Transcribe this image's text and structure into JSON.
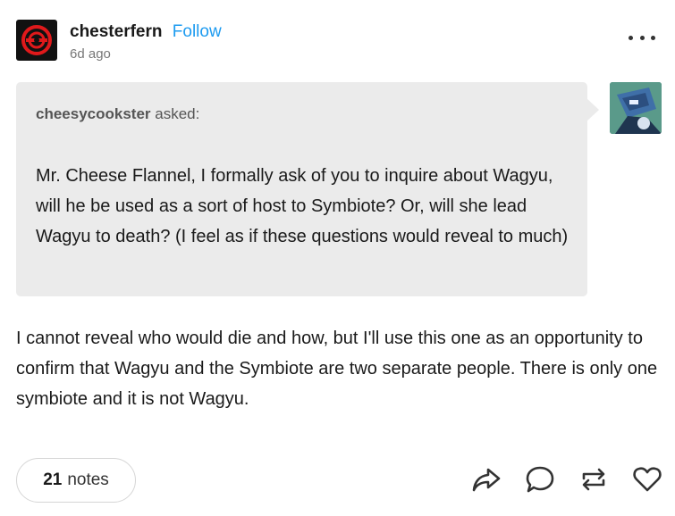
{
  "header": {
    "author": "chesterfern",
    "follow_label": "Follow",
    "timestamp": "6d ago",
    "avatar_icon": "red-circle-logo-icon",
    "more_icon": "more-dots-icon"
  },
  "ask": {
    "asker": "cheesycookster",
    "asked_label": "asked:",
    "question": "Mr. Cheese Flannel, I formally ask of you to inquire about Wagyu, will he be used as a sort of host to Symbiote? Or, will she lead Wagyu to death? (I feel as if these questions would reveal to much)",
    "asker_avatar_icon": "asker-avatar-icon"
  },
  "answer": {
    "text": "I cannot reveal who would die and how, but I'll use this one as an opportunity to confirm that Wagyu and the Symbiote are two separate people. There is only one symbiote and it is not Wagyu."
  },
  "footer": {
    "notes_count": "21",
    "notes_label": "notes",
    "actions": [
      "share-icon",
      "reply-icon",
      "reblog-icon",
      "like-icon"
    ]
  },
  "colors": {
    "follow": "#1d9bf0",
    "bubble": "#ebebeb",
    "avatar_ring": "#e0191b"
  }
}
